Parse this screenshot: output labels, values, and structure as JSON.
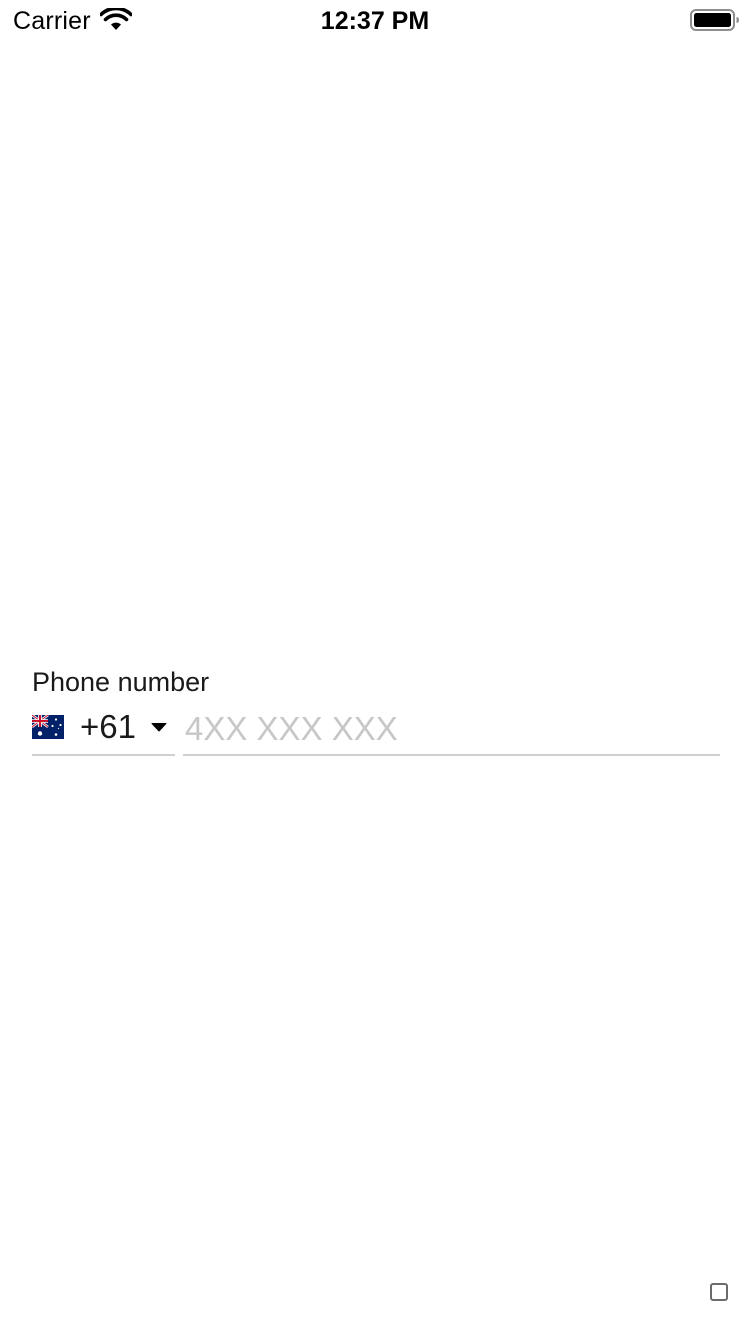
{
  "status_bar": {
    "carrier": "Carrier",
    "time": "12:37 PM",
    "icons": [
      "wifi-icon",
      "battery-icon"
    ]
  },
  "phone_field": {
    "label": "Phone number",
    "country": {
      "flag_icon": "australia-flag-icon",
      "dial_code": "+61",
      "dropdown_icon": "caret-down-icon"
    },
    "input": {
      "value": "",
      "placeholder": "4XX XXX XXX"
    }
  },
  "corner_control": {
    "icon": "checkbox-icon",
    "checked": false
  },
  "colors": {
    "background": "#ffffff",
    "text": "#1a1a1a",
    "placeholder": "#c7c7c7",
    "underline": "#cfcfcf",
    "flag_blue": "#012169",
    "flag_red": "#C8102E"
  }
}
